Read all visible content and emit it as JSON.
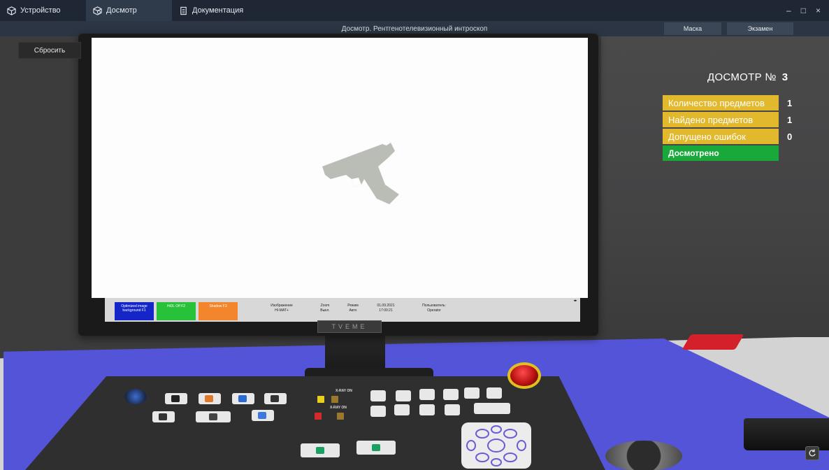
{
  "tabs": [
    {
      "label": "Устройство",
      "icon": "cube-icon"
    },
    {
      "label": "Досмотр",
      "icon": "cube-search-icon"
    },
    {
      "label": "Документация",
      "icon": "document-icon"
    }
  ],
  "window_controls": {
    "minimize": "–",
    "maximize": "□",
    "close": "×"
  },
  "header": {
    "title": "Досмотр. Рентгенотелевизионный интроскоп",
    "mask_label": "Маска",
    "exam_label": "Экзамен"
  },
  "reset_label": "Сбросить",
  "stats": {
    "title": "ДОСМОТР №",
    "number": "3",
    "rows": [
      {
        "label": "Количество предметов",
        "value": "1"
      },
      {
        "label": "Найдено предметов",
        "value": "1"
      },
      {
        "label": "Допущено ошибок",
        "value": "0"
      }
    ],
    "status": "Досмотрено"
  },
  "screen_status": {
    "box1": "Optimized image background F1",
    "box2": "HiDL Off F2",
    "box3": "Shadow F3",
    "image_label": "Изображение",
    "image_value": "HI-MAT+",
    "zoom_label": "Zoom",
    "zoom_value": "Выкл.",
    "mode_label": "Режим",
    "mode_value": "Авто",
    "date": "01.09.2021",
    "time": "17:00:21",
    "user_label": "Пользователь:",
    "user_value": "Operator",
    "corner": "◂▸"
  },
  "logo_text": "TVEME",
  "console": {
    "xray_on_1": "X-RAY ON",
    "xray_on_2": "X-RAY ON"
  },
  "colors": {
    "title_bar": "#1f2734",
    "stat_yellow": "#e2b82c",
    "stat_green": "#19a93a",
    "desk_blue": "#5454d8"
  }
}
